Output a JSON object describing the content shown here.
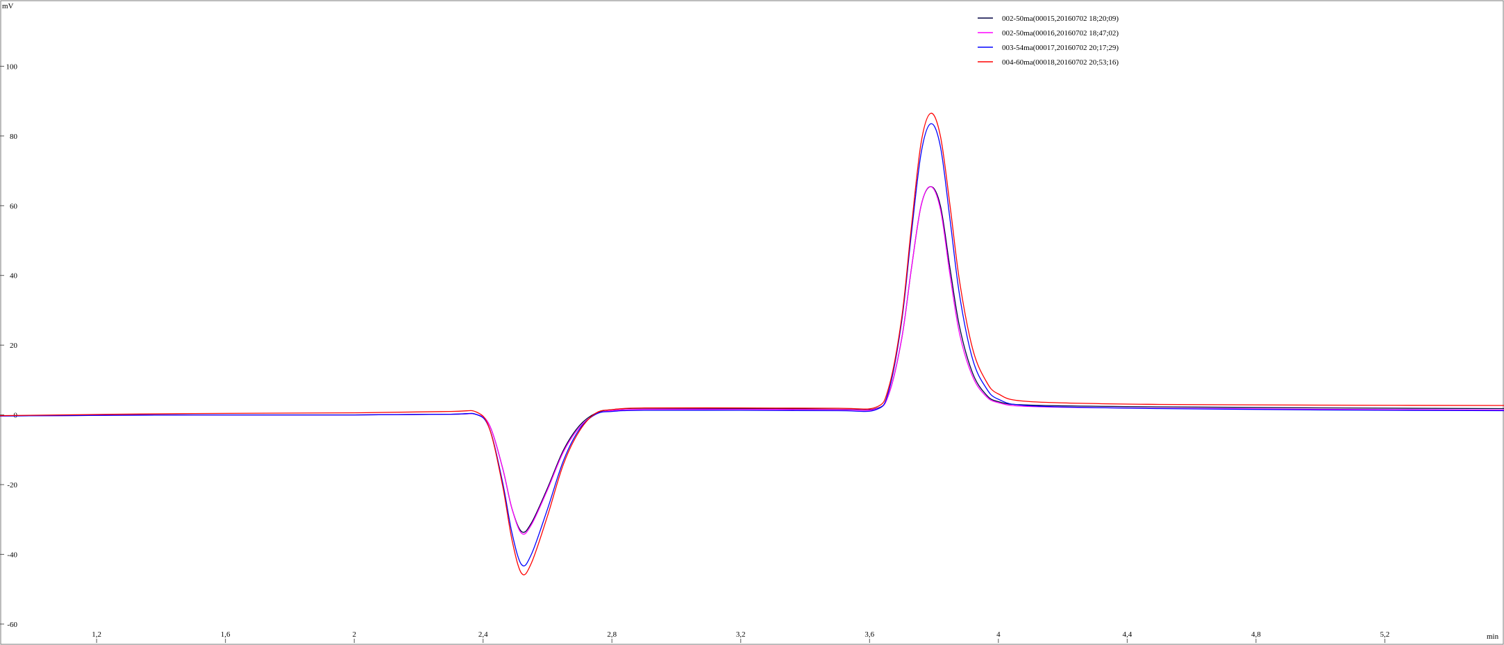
{
  "chart_data": {
    "type": "line",
    "xlabel": "min",
    "ylabel": "mV",
    "xlim": [
      0.9,
      5.57
    ],
    "ylim": [
      -66,
      119
    ],
    "x_ticks": [
      1.2,
      1.6,
      2,
      2.4,
      2.8,
      3.2,
      3.6,
      4,
      4.4,
      4.8,
      5.2
    ],
    "x_tick_labels": [
      "1,2",
      "1,6",
      "2",
      "2,4",
      "2,8",
      "3,2",
      "3,6",
      "4",
      "4,4",
      "4,8",
      "5,2"
    ],
    "y_ticks": [
      100,
      80,
      60,
      40,
      20,
      0,
      -20,
      -40,
      -60
    ],
    "y_tick_labels": [
      "100",
      "80",
      "60",
      "40",
      "20",
      "0",
      "-20",
      "-40",
      "-60"
    ],
    "grid": false,
    "legend_position": "top-right",
    "series": [
      {
        "name": "002-50ma(00015,20160702  18;20;09)",
        "color": "#000040",
        "points": [
          [
            0.9,
            -0.3
          ],
          [
            1.5,
            0.0
          ],
          [
            2.0,
            0.0
          ],
          [
            2.3,
            0.2
          ],
          [
            2.38,
            0.1
          ],
          [
            2.42,
            -3
          ],
          [
            2.46,
            -15
          ],
          [
            2.49,
            -27
          ],
          [
            2.52,
            -33.5
          ],
          [
            2.55,
            -31
          ],
          [
            2.6,
            -21
          ],
          [
            2.65,
            -10
          ],
          [
            2.7,
            -3
          ],
          [
            2.75,
            0.5
          ],
          [
            2.8,
            1.5
          ],
          [
            2.9,
            1.9
          ],
          [
            3.2,
            1.8
          ],
          [
            3.5,
            1.6
          ],
          [
            3.62,
            1.8
          ],
          [
            3.66,
            6
          ],
          [
            3.7,
            22
          ],
          [
            3.73,
            42
          ],
          [
            3.76,
            60
          ],
          [
            3.79,
            65.5
          ],
          [
            3.82,
            60
          ],
          [
            3.85,
            42
          ],
          [
            3.88,
            25
          ],
          [
            3.92,
            12
          ],
          [
            3.96,
            6
          ],
          [
            4.0,
            3.8
          ],
          [
            4.1,
            2.8
          ],
          [
            4.5,
            2.3
          ],
          [
            5.0,
            2.0
          ],
          [
            5.57,
            1.8
          ]
        ]
      },
      {
        "name": "002-50ma(00016,20160702  18;47;02)",
        "color": "#ff00ff",
        "points": [
          [
            0.9,
            -0.3
          ],
          [
            1.5,
            0.0
          ],
          [
            2.0,
            0.0
          ],
          [
            2.3,
            0.2
          ],
          [
            2.38,
            0.1
          ],
          [
            2.42,
            -3
          ],
          [
            2.46,
            -15
          ],
          [
            2.49,
            -27
          ],
          [
            2.52,
            -34
          ],
          [
            2.55,
            -31.5
          ],
          [
            2.6,
            -21.5
          ],
          [
            2.65,
            -10.5
          ],
          [
            2.7,
            -3.5
          ],
          [
            2.75,
            0.2
          ],
          [
            2.8,
            1.2
          ],
          [
            2.9,
            1.6
          ],
          [
            3.2,
            1.6
          ],
          [
            3.5,
            1.5
          ],
          [
            3.62,
            1.7
          ],
          [
            3.66,
            6
          ],
          [
            3.7,
            22
          ],
          [
            3.73,
            42
          ],
          [
            3.76,
            60
          ],
          [
            3.79,
            65.5
          ],
          [
            3.82,
            59
          ],
          [
            3.85,
            40
          ],
          [
            3.88,
            23
          ],
          [
            3.92,
            11
          ],
          [
            3.96,
            5.5
          ],
          [
            4.0,
            3.5
          ],
          [
            4.1,
            2.4
          ],
          [
            4.5,
            1.9
          ],
          [
            5.0,
            1.6
          ],
          [
            5.57,
            1.4
          ]
        ]
      },
      {
        "name": "003-54ma(00017,20160702  20;17;29)",
        "color": "#0000ff",
        "points": [
          [
            0.9,
            -0.3
          ],
          [
            1.5,
            0.0
          ],
          [
            2.0,
            0.0
          ],
          [
            2.3,
            0.2
          ],
          [
            2.38,
            0.1
          ],
          [
            2.42,
            -4
          ],
          [
            2.46,
            -19
          ],
          [
            2.49,
            -34
          ],
          [
            2.52,
            -43
          ],
          [
            2.55,
            -40
          ],
          [
            2.6,
            -27
          ],
          [
            2.65,
            -13
          ],
          [
            2.7,
            -4
          ],
          [
            2.75,
            0.2
          ],
          [
            2.8,
            1.0
          ],
          [
            2.9,
            1.3
          ],
          [
            3.2,
            1.3
          ],
          [
            3.5,
            1.2
          ],
          [
            3.62,
            1.5
          ],
          [
            3.66,
            7
          ],
          [
            3.7,
            27
          ],
          [
            3.73,
            52
          ],
          [
            3.76,
            75
          ],
          [
            3.79,
            83.5
          ],
          [
            3.82,
            77
          ],
          [
            3.85,
            56
          ],
          [
            3.88,
            34
          ],
          [
            3.92,
            16
          ],
          [
            3.96,
            8
          ],
          [
            4.0,
            4.5
          ],
          [
            4.1,
            2.6
          ],
          [
            4.5,
            1.8
          ],
          [
            5.0,
            1.4
          ],
          [
            5.57,
            1.2
          ]
        ]
      },
      {
        "name": "004-60ma(00018,20160702  20;53;16)",
        "color": "#ff0000",
        "points": [
          [
            0.9,
            -0.2
          ],
          [
            1.5,
            0.4
          ],
          [
            2.0,
            0.6
          ],
          [
            2.3,
            1.0
          ],
          [
            2.38,
            0.8
          ],
          [
            2.42,
            -4
          ],
          [
            2.46,
            -20
          ],
          [
            2.49,
            -36
          ],
          [
            2.52,
            -45.5
          ],
          [
            2.55,
            -42.5
          ],
          [
            2.6,
            -29
          ],
          [
            2.65,
            -14
          ],
          [
            2.7,
            -4.5
          ],
          [
            2.75,
            0.5
          ],
          [
            2.8,
            1.5
          ],
          [
            2.9,
            2.0
          ],
          [
            3.2,
            2.0
          ],
          [
            3.5,
            1.9
          ],
          [
            3.62,
            2.2
          ],
          [
            3.66,
            8
          ],
          [
            3.7,
            28
          ],
          [
            3.73,
            54
          ],
          [
            3.76,
            78
          ],
          [
            3.79,
            86.5
          ],
          [
            3.82,
            80
          ],
          [
            3.85,
            60
          ],
          [
            3.88,
            38
          ],
          [
            3.92,
            19
          ],
          [
            3.96,
            10
          ],
          [
            4.0,
            6
          ],
          [
            4.1,
            3.8
          ],
          [
            4.5,
            3.0
          ],
          [
            5.0,
            2.8
          ],
          [
            5.57,
            2.7
          ]
        ]
      }
    ]
  }
}
